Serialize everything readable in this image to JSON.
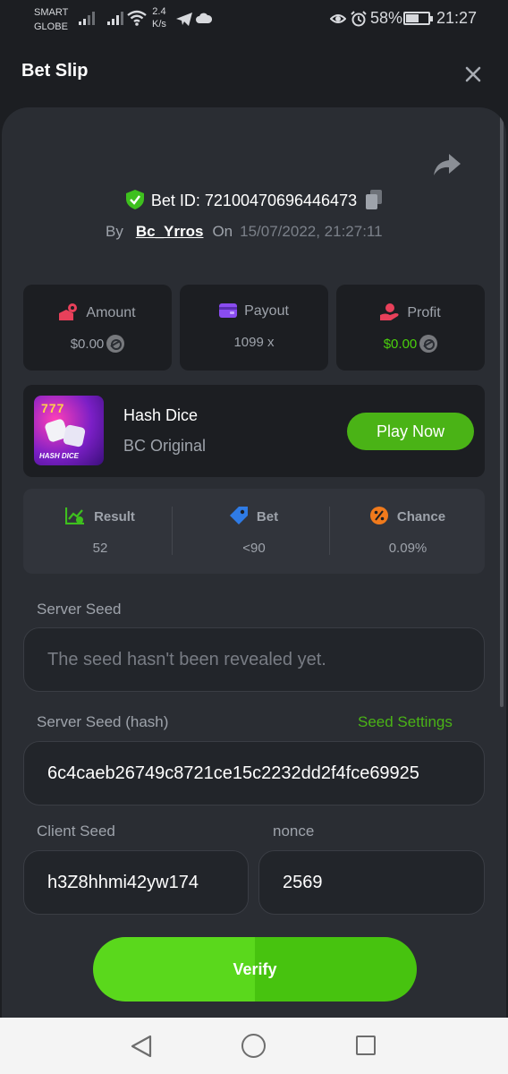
{
  "status_bar": {
    "carrier_line1": "SMART",
    "carrier_line2": "GLOBE",
    "speed_value": "2.4",
    "speed_unit": "K/s",
    "battery_percent": "58%",
    "battery_level": 0.58,
    "time": "21:27"
  },
  "header": {
    "title": "Bet Slip",
    "close_icon": "close-icon"
  },
  "bet": {
    "id_label": "Bet ID: 72100470696446473",
    "by_label": "By",
    "username": "Bc_Yrros",
    "on_label": "On",
    "date": "15/07/2022, 21:27:11"
  },
  "stats": {
    "amount_label": "Amount",
    "amount_value": "$0.00",
    "payout_label": "Payout",
    "payout_value": "1099 x",
    "profit_label": "Profit",
    "profit_value": "$0.00"
  },
  "game": {
    "thumb_sevens": "777",
    "thumb_text": "HASH DICE",
    "name": "Hash Dice",
    "subtitle": "BC Original",
    "play_label": "Play Now"
  },
  "result": {
    "result_label": "Result",
    "result_value": "52",
    "bet_label": "Bet",
    "bet_value": "<90",
    "chance_label": "Chance",
    "chance_value": "0.09%"
  },
  "seeds": {
    "server_seed_label": "Server Seed",
    "server_seed_placeholder": "The seed hasn't been revealed yet.",
    "server_hash_label": "Server Seed (hash)",
    "seed_settings_label": "Seed Settings",
    "server_hash_value": "6c4caeb26749c8721ce15c2232dd2f4fce69925",
    "client_seed_label": "Client Seed",
    "client_seed_value": "h3Z8hhmi42yw174",
    "nonce_label": "nonce",
    "nonce_value": "2569"
  },
  "verify_label": "Verify",
  "colors": {
    "accent_green": "#4ab316",
    "background": "#1c1e22",
    "panel": "#2a2d33"
  }
}
